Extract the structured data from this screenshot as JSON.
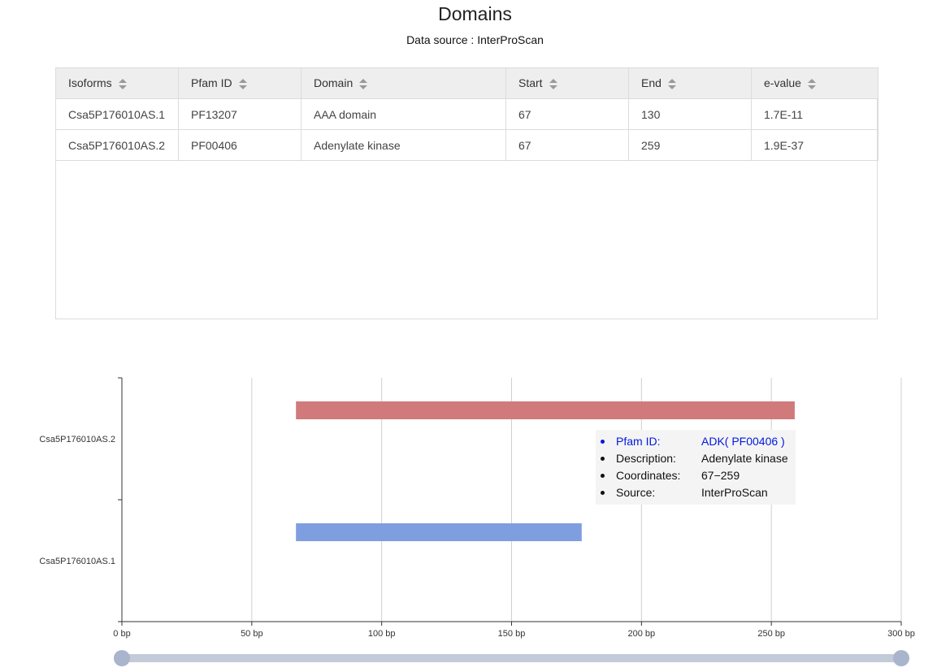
{
  "page": {
    "title": "Domains",
    "subtitle": "Data source : InterProScan"
  },
  "table": {
    "columns": [
      "Isoforms",
      "Pfam ID",
      "Domain",
      "Start",
      "End",
      "e-value"
    ],
    "rows": [
      [
        "Csa5P176010AS.1",
        "PF13207",
        "AAA domain",
        "67",
        "130",
        "1.7E-11"
      ],
      [
        "Csa5P176010AS.2",
        "PF00406",
        "Adenylate kinase",
        "67",
        "259",
        "1.9E-37"
      ]
    ]
  },
  "chart_data": {
    "type": "bar",
    "orientation": "horizontal-range",
    "categories": [
      "Csa5P176010AS.1",
      "Csa5P176010AS.2"
    ],
    "ranges": [
      {
        "category": "Csa5P176010AS.1",
        "start": 67,
        "end": 177,
        "color": "#7f9ee0"
      },
      {
        "category": "Csa5P176010AS.2",
        "start": 67,
        "end": 259,
        "color": "#d07a7c"
      }
    ],
    "xlim": [
      0,
      300
    ],
    "xticks": [
      "0 bp",
      "50 bp",
      "100 bp",
      "150 bp",
      "200 bp",
      "250 bp",
      "300 bp"
    ],
    "grid": true,
    "zoom_slider": {
      "start_fraction": 0.0,
      "end_fraction": 1.0
    }
  },
  "tooltip": {
    "pfam_label": "Pfam ID:",
    "pfam_value": "ADK( PF00406 )",
    "desc_label": "Description:",
    "desc_value": "Adenylate kinase",
    "coord_label": "Coordinates:",
    "coord_value": "67−259",
    "source_label": "Source:",
    "source_value": "InterProScan"
  },
  "colors": {
    "slider_track": "#c3cbd8",
    "slider_handle": "#a8b5cc"
  }
}
